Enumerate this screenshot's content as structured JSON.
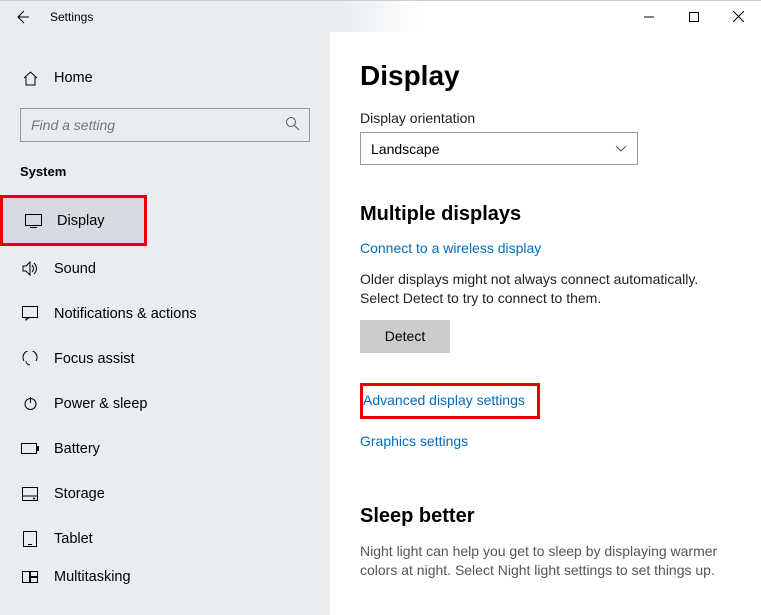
{
  "window": {
    "title": "Settings"
  },
  "sidebar": {
    "home_label": "Home",
    "search_placeholder": "Find a setting",
    "section_label": "System",
    "items": [
      {
        "label": "Display"
      },
      {
        "label": "Sound"
      },
      {
        "label": "Notifications & actions"
      },
      {
        "label": "Focus assist"
      },
      {
        "label": "Power & sleep"
      },
      {
        "label": "Battery"
      },
      {
        "label": "Storage"
      },
      {
        "label": "Tablet"
      },
      {
        "label": "Multitasking"
      }
    ]
  },
  "content": {
    "title": "Display",
    "orientation": {
      "label": "Display orientation",
      "value": "Landscape"
    },
    "multiple": {
      "heading": "Multiple displays",
      "wireless_link": "Connect to a wireless display",
      "detect_desc": "Older displays might not always connect automatically. Select Detect to try to connect to them.",
      "detect_btn": "Detect",
      "advanced_link": "Advanced display settings",
      "graphics_link": "Graphics settings"
    },
    "sleep": {
      "heading": "Sleep better",
      "desc": "Night light can help you get to sleep by displaying warmer colors at night. Select Night light settings to set things up."
    }
  }
}
